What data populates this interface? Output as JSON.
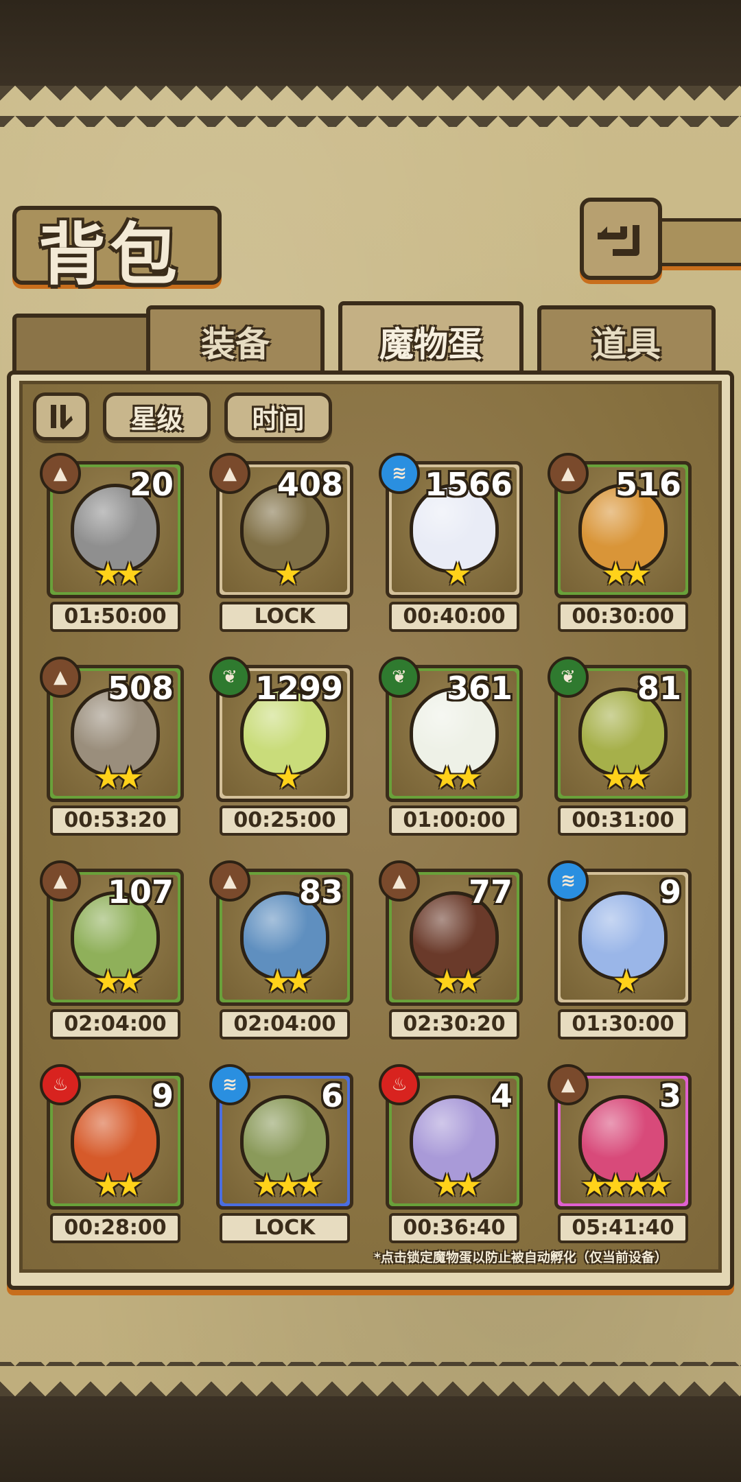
{
  "header": {
    "title": "背包"
  },
  "tabs": [
    {
      "label": "装备",
      "active": false
    },
    {
      "label": "魔物蛋",
      "active": true
    },
    {
      "label": "道具",
      "active": false
    }
  ],
  "sort": {
    "star_label": "星级",
    "time_label": "时间",
    "order_icon": "sort-order-icon"
  },
  "eggs": [
    {
      "count": "20",
      "element": "earth",
      "stars": 2,
      "timer": "01:50:00",
      "frame": "green",
      "color": "#8f8f8f"
    },
    {
      "count": "408",
      "element": "earth",
      "stars": 1,
      "timer": "LOCK",
      "frame": "tan",
      "color": "#7f6f45"
    },
    {
      "count": "1566",
      "element": "water",
      "stars": 1,
      "timer": "00:40:00",
      "frame": "tan",
      "color": "#e9ecf6"
    },
    {
      "count": "516",
      "element": "earth",
      "stars": 2,
      "timer": "00:30:00",
      "frame": "green",
      "color": "#d99538"
    },
    {
      "count": "508",
      "element": "earth",
      "stars": 2,
      "timer": "00:53:20",
      "frame": "green",
      "color": "#9a8e7c"
    },
    {
      "count": "1299",
      "element": "grass",
      "stars": 1,
      "timer": "00:25:00",
      "frame": "tan",
      "color": "#c9dc7a"
    },
    {
      "count": "361",
      "element": "grass",
      "stars": 2,
      "timer": "01:00:00",
      "frame": "green",
      "color": "#eef1e7"
    },
    {
      "count": "81",
      "element": "grass",
      "stars": 2,
      "timer": "00:31:00",
      "frame": "green",
      "color": "#a6b04a"
    },
    {
      "count": "107",
      "element": "earth",
      "stars": 2,
      "timer": "02:04:00",
      "frame": "green",
      "color": "#8fb05a"
    },
    {
      "count": "83",
      "element": "earth",
      "stars": 2,
      "timer": "02:04:00",
      "frame": "green",
      "color": "#5f8fbf"
    },
    {
      "count": "77",
      "element": "earth",
      "stars": 2,
      "timer": "02:30:20",
      "frame": "green",
      "color": "#6a3a2a"
    },
    {
      "count": "9",
      "element": "water",
      "stars": 1,
      "timer": "01:30:00",
      "frame": "tan",
      "color": "#9ab6e8"
    },
    {
      "count": "9",
      "element": "fire",
      "stars": 2,
      "timer": "00:28:00",
      "frame": "green",
      "color": "#d65a2a"
    },
    {
      "count": "6",
      "element": "water",
      "stars": 3,
      "timer": "LOCK",
      "frame": "blue",
      "color": "#8a9a5a"
    },
    {
      "count": "4",
      "element": "fire",
      "stars": 2,
      "timer": "00:36:40",
      "frame": "green",
      "color": "#a99ad8"
    },
    {
      "count": "3",
      "element": "earth",
      "stars": 4,
      "timer": "05:41:40",
      "frame": "pink",
      "color": "#d84a7a"
    }
  ],
  "footnote": "*点击锁定魔物蛋以防止被自动孵化（仅当前设备）",
  "icons": {
    "back": "back-arrow-icon",
    "earth": "earth-element-icon",
    "water": "water-element-icon",
    "grass": "grass-element-icon",
    "fire": "fire-element-icon",
    "star": "star-icon"
  }
}
